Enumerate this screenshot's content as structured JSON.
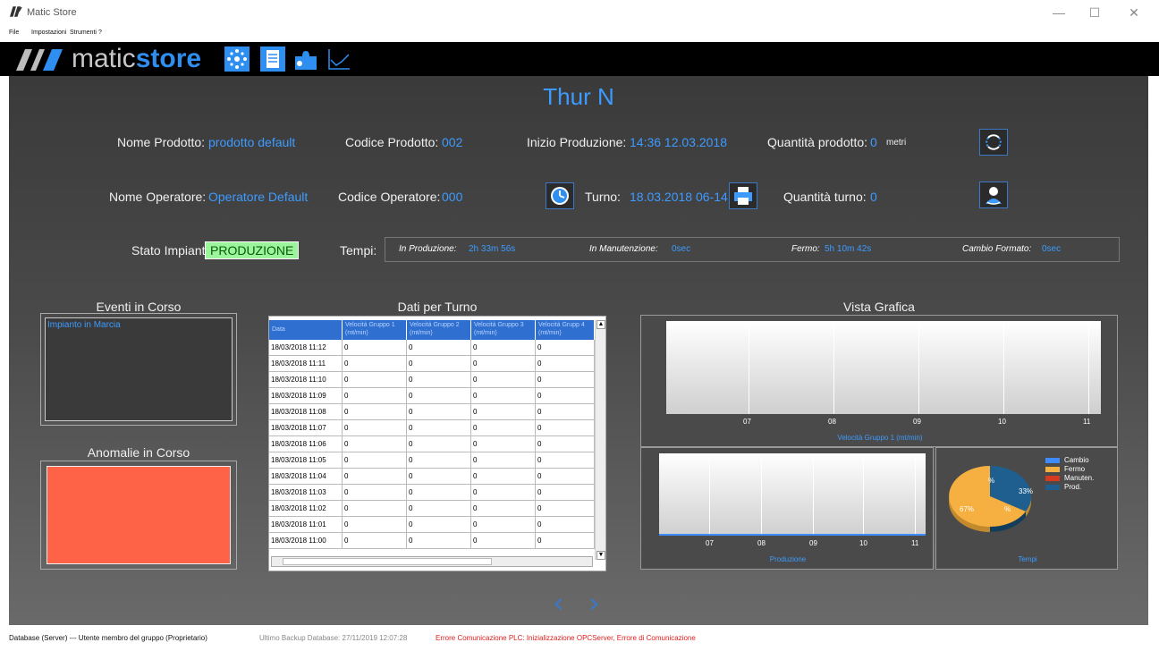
{
  "window": {
    "title": "Matic Store"
  },
  "menu": {
    "items": [
      "File",
      "Impostazioni",
      "Strumenti",
      "?"
    ]
  },
  "toolbar": {
    "brand_left": "matic",
    "brand_right": "store",
    "buttons": [
      "dashboard-icon",
      "document-icon",
      "puzzle-icon",
      "chart-icon"
    ]
  },
  "main": {
    "title": "Thur N",
    "nome_prodotto_label": "Nome Prodotto:",
    "nome_prodotto_value": "prodotto default",
    "codice_prodotto_label": "Codice Prodotto:",
    "codice_prodotto_value": "002",
    "inizio_produzione_label": "Inizio Produzione:",
    "inizio_produzione_value": "14:36 12.03.2018",
    "quantita_prodotto_label": "Quantità prodotto:",
    "quantita_prodotto_value": "0",
    "quantita_prodotto_unit": "metri",
    "nome_operatore_label": "Nome Operatore:",
    "nome_operatore_value": "Operatore Default",
    "codice_operatore_label": "Codice Operatore:",
    "codice_operatore_value": "000",
    "turno_label": "Turno:",
    "turno_value": "18.03.2018 06-14",
    "quantita_turno_label": "Quantità turno:",
    "quantita_turno_value": "0",
    "stato_impianto_label": "Stato Impianto:",
    "stato_impianto_value": "PRODUZIONE",
    "tempi_label": "Tempi:",
    "tempi": {
      "in_produzione_label": "In Produzione:",
      "in_produzione_value": "2h 33m 56s",
      "in_manutenzione_label": "In Manutenzione:",
      "in_manutenzione_value": "0sec",
      "fermo_label": "Fermo:",
      "fermo_value": "5h 10m 42s",
      "cambio_formato_label": "Cambio Formato:",
      "cambio_formato_value": "0sec"
    }
  },
  "eventi": {
    "title": "Eventi in Corso",
    "items": [
      "Impianto in Marcia"
    ]
  },
  "anomalie": {
    "title": "Anomalie in Corso",
    "color": "#ff6347"
  },
  "dati_turno": {
    "title": "Dati per Turno",
    "columns": [
      "Data",
      "Velocità Gruppo 1 (mt/min)",
      "Velocità Gruppo 2 (mt/min)",
      "Velocità Gruppo 3 (mt/min)",
      "Velocità Grupp 4 (mt/min)"
    ],
    "rows": [
      [
        "18/03/2018 11:12",
        "0",
        "0",
        "0",
        "0"
      ],
      [
        "18/03/2018 11:11",
        "0",
        "0",
        "0",
        "0"
      ],
      [
        "18/03/2018 11:10",
        "0",
        "0",
        "0",
        "0"
      ],
      [
        "18/03/2018 11:09",
        "0",
        "0",
        "0",
        "0"
      ],
      [
        "18/03/2018 11:08",
        "0",
        "0",
        "0",
        "0"
      ],
      [
        "18/03/2018 11:07",
        "0",
        "0",
        "0",
        "0"
      ],
      [
        "18/03/2018 11:06",
        "0",
        "0",
        "0",
        "0"
      ],
      [
        "18/03/2018 11:05",
        "0",
        "0",
        "0",
        "0"
      ],
      [
        "18/03/2018 11:04",
        "0",
        "0",
        "0",
        "0"
      ],
      [
        "18/03/2018 11:03",
        "0",
        "0",
        "0",
        "0"
      ],
      [
        "18/03/2018 11:02",
        "0",
        "0",
        "0",
        "0"
      ],
      [
        "18/03/2018 11:01",
        "0",
        "0",
        "0",
        "0"
      ],
      [
        "18/03/2018 11:00",
        "0",
        "0",
        "0",
        "0"
      ]
    ]
  },
  "vista_grafica": {
    "title": "Vista Grafica",
    "chart1_caption": "Velocità Gruppo 1 (mt/min)",
    "chart1_ticks": [
      "07",
      "08",
      "09",
      "10",
      "11"
    ],
    "chart2_caption": "Produzione",
    "chart2_ticks": [
      "07",
      "08",
      "09",
      "10",
      "11"
    ],
    "chart3_caption": "Tempi",
    "pie_labels": {
      "prod": "33%",
      "fermo": "67%",
      "small1": "%",
      "small2": "%"
    },
    "legend": [
      {
        "label": "Cambio",
        "color": "#3d8bff"
      },
      {
        "label": "Fermo",
        "color": "#f5b041"
      },
      {
        "label": "Manuten.",
        "color": "#d63a1f"
      },
      {
        "label": "Prod.",
        "color": "#1f5f8f"
      }
    ]
  },
  "nav": {
    "prev": "‹",
    "next": "›"
  },
  "statusbar": {
    "left": "Database (Server) --- Utente membro del gruppo (Proprietario)",
    "backup": "Ultimo Backup Database: 27/11/2019 12:07:28",
    "error": "Errore Comunicazione PLC: Inizializzazione OPCServer, Errore di Comunicazione"
  }
}
